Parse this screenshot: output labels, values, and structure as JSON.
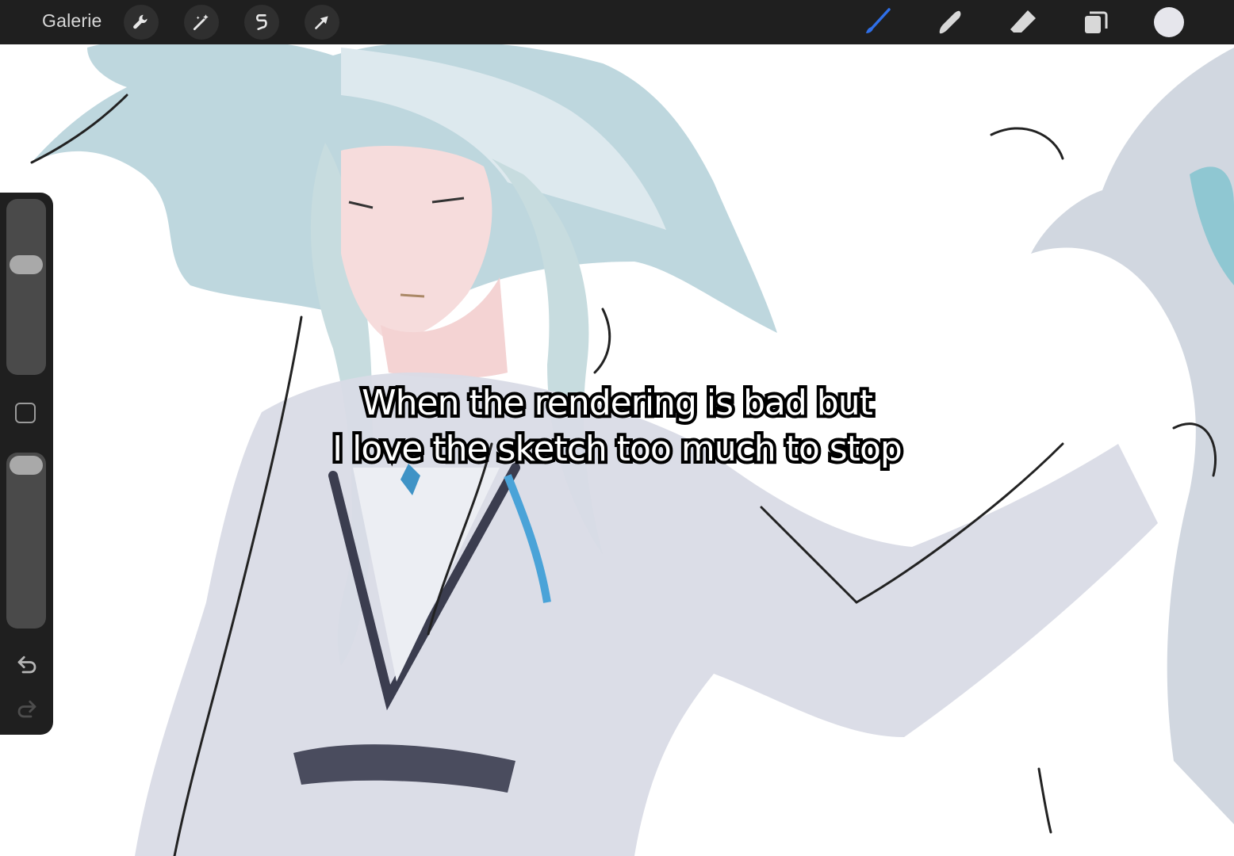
{
  "topbar": {
    "gallery_label": "Galerie",
    "left_tools": [
      {
        "name": "actions-button",
        "icon": "wrench-icon"
      },
      {
        "name": "adjustments-button",
        "icon": "magic-wand-icon"
      },
      {
        "name": "selection-button",
        "icon": "selection-s-icon"
      },
      {
        "name": "transform-button",
        "icon": "arrow-cursor-icon"
      }
    ],
    "right_tools": [
      {
        "name": "brush-tool-button",
        "icon": "brush-icon",
        "active": true
      },
      {
        "name": "smudge-tool-button",
        "icon": "smudge-finger-icon",
        "active": false
      },
      {
        "name": "eraser-tool-button",
        "icon": "eraser-icon",
        "active": false
      },
      {
        "name": "layers-button",
        "icon": "layers-icon",
        "active": false
      }
    ],
    "current_color": "#e6e6ec",
    "active_tool_color": "#2f6fe8"
  },
  "sidebar": {
    "brush_size_level": 0.65,
    "opacity_level": 1.0,
    "modify_button_icon": "square-icon",
    "undo_icon": "undo-icon",
    "redo_icon": "redo-icon"
  },
  "caption": {
    "line1": "When the rendering is bad but",
    "line2": "I love the sketch too much to stop"
  }
}
